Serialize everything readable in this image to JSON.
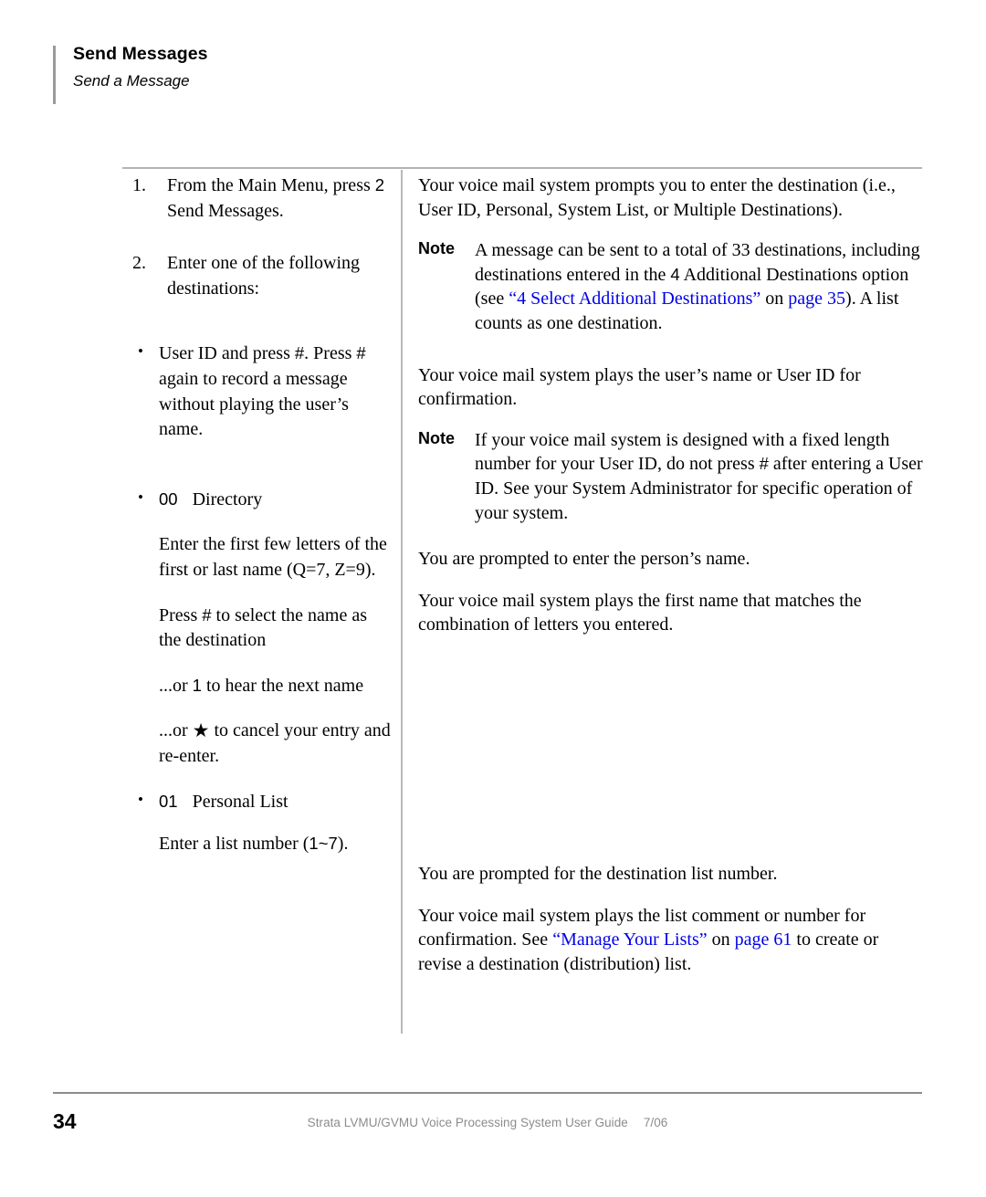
{
  "header": {
    "title": "Send Messages",
    "subtitle": "Send a Message"
  },
  "steps": [
    {
      "number": "1.",
      "text_before_key": "From the Main Menu, press ",
      "key": "2",
      "text_after_key": "Send Messages."
    },
    {
      "number": "2.",
      "text": "Enter one of the following destinations:"
    }
  ],
  "left_items": {
    "bullet_glyph": "•",
    "user_id": {
      "line1_a": "User ID and press ",
      "line1_key": "#",
      "line1_b": ".",
      "line2_a": "Press ",
      "line2_key": "#",
      "line2_b": " again to record a message without playing the user’s name."
    },
    "directory": {
      "key": "00",
      "label": "Directory",
      "para1": "Enter the first few letters of the first or last name (Q=7, Z=9).",
      "para2_a": "Press ",
      "para2_key": "#",
      "para2_b": " to select the name as the destination",
      "para3_a": "...or ",
      "para3_key": "1",
      "para3_b": " to hear the next name",
      "para4_a": "...or ",
      "para4_key": "★",
      "para4_b": " to cancel your entry and re-enter."
    },
    "personal_list": {
      "key": "01",
      "label": "Personal List",
      "para_a": "Enter a list number (",
      "para_key": "1~7",
      "para_b": ")."
    }
  },
  "right_items": {
    "prompt_destination": "Your voice mail system prompts you to enter the destination (i.e., User ID, Personal, System List, or Multiple Destinations).",
    "note1": {
      "label": "Note",
      "text_a": "A message can be sent to a total of 33 destinations, including destinations entered in the ",
      "key": "4",
      "text_b": " Additional Destinations option (see ",
      "link_open_quote": "“4 Select Additional Destinations”",
      "text_c": " on ",
      "link_page": "page 35",
      "text_d": "). A list counts as one destination."
    },
    "plays_user_name": "Your voice mail system plays the user’s name or User ID for confirmation.",
    "note2": {
      "label": "Note",
      "text_a": "If your voice mail system is designed with a fixed length number for your User ID, do not press ",
      "key": "#",
      "text_b": " after entering a User ID. See your System Administrator for specific operation of your system."
    },
    "prompted_person_name": "You are prompted to enter the person’s name.",
    "plays_first_name": "Your voice mail system plays the first name that matches the combination of letters you entered.",
    "prompted_list_number": "You are prompted for the destination list number.",
    "plays_list_comment": {
      "text_a": "Your voice mail system plays the list comment or number for confirmation. See ",
      "link_title": "“Manage Your Lists”",
      "text_b": " on ",
      "link_page": "page 61",
      "text_c": " to create or revise a destination (distribution) list."
    }
  },
  "footer": {
    "page_number": "34",
    "guide_title": "Strata LVMU/GVMU Voice Processing System User Guide",
    "date": "7/06"
  },
  "colors": {
    "link": "#0000e8",
    "rule": "#b3b3b3",
    "footer_text": "#8c8c8c"
  }
}
